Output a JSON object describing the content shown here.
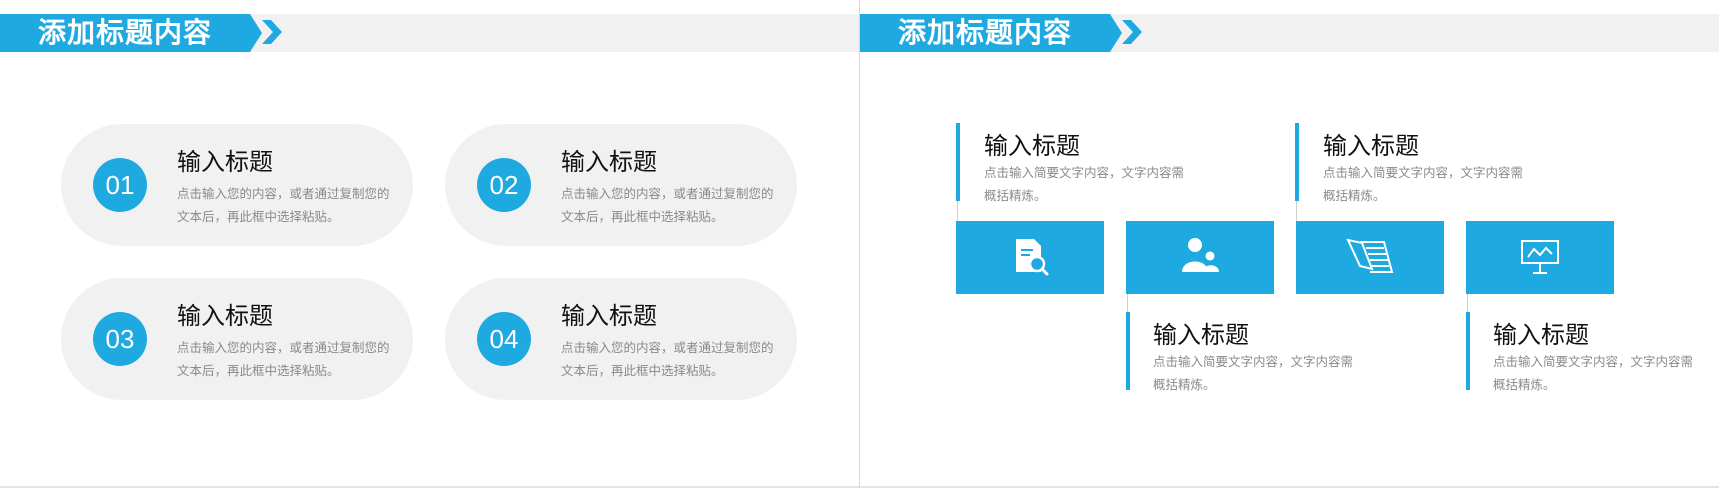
{
  "slides": [
    {
      "header": "添加标题内容",
      "items": [
        {
          "num": "01",
          "title": "输入标题",
          "desc": "点击输入您的内容，或者通过复制您的文本后，再此框中选择粘贴。"
        },
        {
          "num": "02",
          "title": "输入标题",
          "desc": "点击输入您的内容，或者通过复制您的文本后，再此框中选择粘贴。"
        },
        {
          "num": "03",
          "title": "输入标题",
          "desc": "点击输入您的内容，或者通过复制您的文本后，再此框中选择粘贴。"
        },
        {
          "num": "04",
          "title": "输入标题",
          "desc": "点击输入您的内容，或者通过复制您的文本后，再此框中选择粘贴。"
        }
      ]
    },
    {
      "header": "添加标题内容",
      "items": [
        {
          "icon": "document-search-icon",
          "title": "输入标题",
          "desc": "点击输入简要文字内容，文字内容需概括精炼。"
        },
        {
          "icon": "users-icon",
          "title": "输入标题",
          "desc": "点击输入简要文字内容，文字内容需概括精炼。"
        },
        {
          "icon": "newspaper-icon",
          "title": "输入标题",
          "desc": "点击输入简要文字内容，文字内容需概括精炼。"
        },
        {
          "icon": "presentation-board-icon",
          "title": "输入标题",
          "desc": "点击输入简要文字内容，文字内容需概括精炼。"
        }
      ]
    }
  ],
  "colors": {
    "accent": "#1ea9e1",
    "pill": "#f1f1f1",
    "header_strip": "#f1f1f1"
  }
}
